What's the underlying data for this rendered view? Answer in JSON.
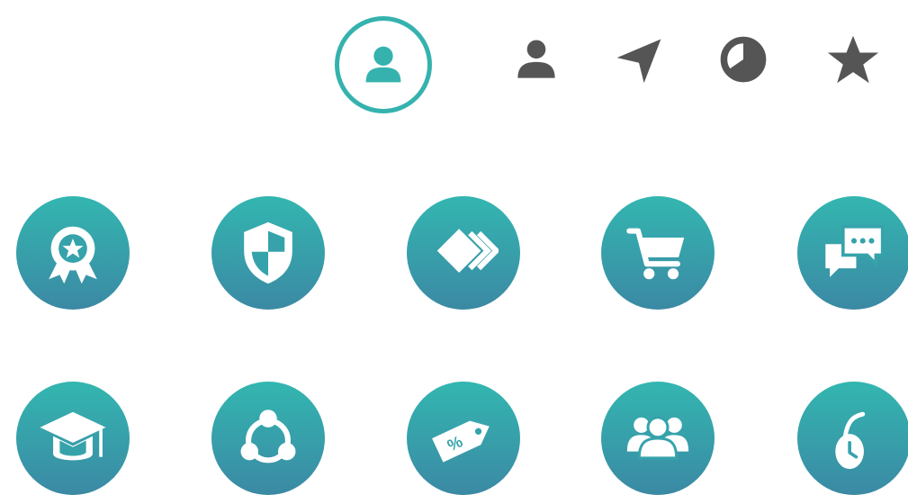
{
  "colors": {
    "accent": "#35b2ae",
    "gradient_top": "#33b6b0",
    "gradient_bottom": "#3b89a4",
    "inactive_icon": "#555555",
    "icon_fg": "#ffffff"
  },
  "top_bar": {
    "selected": "user-icon",
    "icons": [
      "user-icon",
      "navigation-icon",
      "pie-chart-icon",
      "star-icon"
    ]
  },
  "grid": {
    "rows": [
      [
        "award-icon",
        "shield-icon",
        "forward-cards-icon",
        "shopping-cart-icon",
        "chat-icon"
      ],
      [
        "graduation-cap-icon",
        "share-icon",
        "discount-tag-icon",
        "group-icon",
        "mouse-clock-icon"
      ]
    ]
  }
}
